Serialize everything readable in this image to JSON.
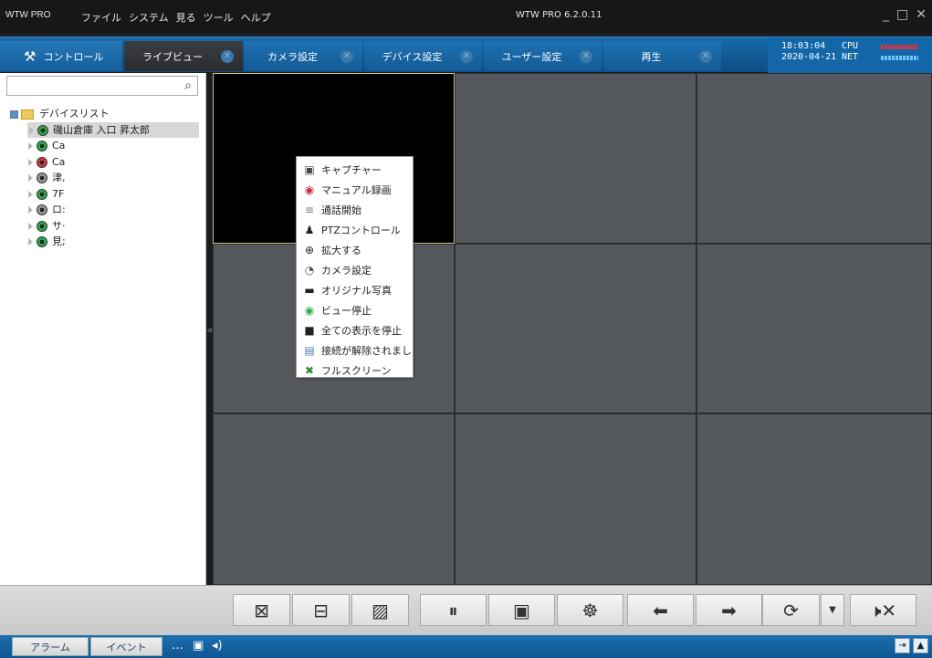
{
  "titlebar": {
    "app": "WTW PRO",
    "menus": [
      "ファイル",
      "システム",
      "見る",
      "ツール",
      "ヘルプ"
    ],
    "version": "WTW PRO 6.2.0.11",
    "minimize": "_",
    "maximize": "□",
    "close": "✕"
  },
  "tabs": [
    {
      "label": "コントロール"
    },
    {
      "label": "ライブビュー"
    },
    {
      "label": "カメラ設定"
    },
    {
      "label": "デバイス設定"
    },
    {
      "label": "ユーザー設定"
    },
    {
      "label": "再生"
    }
  ],
  "status": {
    "time": "18:03:04",
    "date": "2020-04-21",
    "cpu": "CPU",
    "net": "NET",
    "cpu_color": "#e0303a",
    "net_color": "#6fc3ff"
  },
  "sidebar": {
    "search_value": "",
    "root": "デバイスリスト",
    "items": [
      {
        "label": "磯山倉庫 入口 昇太郎",
        "status": "on"
      },
      {
        "label": "Ca",
        "status": "on"
      },
      {
        "label": "Ca",
        "status": "off"
      },
      {
        "label": "津,",
        "status": "gray"
      },
      {
        "label": "7F",
        "status": "on"
      },
      {
        "label": "ロ:",
        "status": "gray"
      },
      {
        "label": "サ‧",
        "status": "on"
      },
      {
        "label": "見;",
        "status": "on"
      }
    ]
  },
  "context_menu": [
    {
      "label": "キャプチャー",
      "icon": "camera-icon"
    },
    {
      "label": "マニュアル録画",
      "icon": "record-icon"
    },
    {
      "label": "通話開始",
      "icon": "microphone-icon"
    },
    {
      "label": "PTZコントロール",
      "icon": "ptz-icon"
    },
    {
      "label": "拡大する",
      "icon": "zoom-icon"
    },
    {
      "label": "カメラ設定",
      "icon": "camera-settings-icon"
    },
    {
      "label": "オリジナル写真",
      "icon": "original-photo-icon"
    },
    {
      "label": "ビュー停止",
      "icon": "stop-view-icon"
    },
    {
      "label": "全ての表示を停止",
      "icon": "stop-all-icon"
    },
    {
      "label": "接続が解除されまし",
      "icon": "disconnect-icon"
    },
    {
      "label": "フルスクリーン",
      "icon": "fullscreen-icon"
    }
  ],
  "toolbar": [
    {
      "name": "fullscreen-button",
      "icon": "fullscreen-icon"
    },
    {
      "name": "layout-button",
      "icon": "layout-icon"
    },
    {
      "name": "image-search-button",
      "icon": "image-search-icon"
    },
    {
      "name": "pause-button",
      "icon": "pause-icon"
    },
    {
      "name": "snapshot-button",
      "icon": "camera-icon"
    },
    {
      "name": "ptz-wheel-button",
      "icon": "wheel-icon"
    },
    {
      "name": "prev-button",
      "icon": "arrow-left-icon"
    },
    {
      "name": "next-button",
      "icon": "arrow-right-icon"
    },
    {
      "name": "refresh-button",
      "icon": "refresh-icon"
    },
    {
      "name": "refresh-dropdown-button",
      "icon": "chevron-down-icon"
    },
    {
      "name": "mute-button",
      "icon": "mute-icon"
    }
  ],
  "statusbar": {
    "alarm": "アラーム",
    "event": "イベント"
  }
}
